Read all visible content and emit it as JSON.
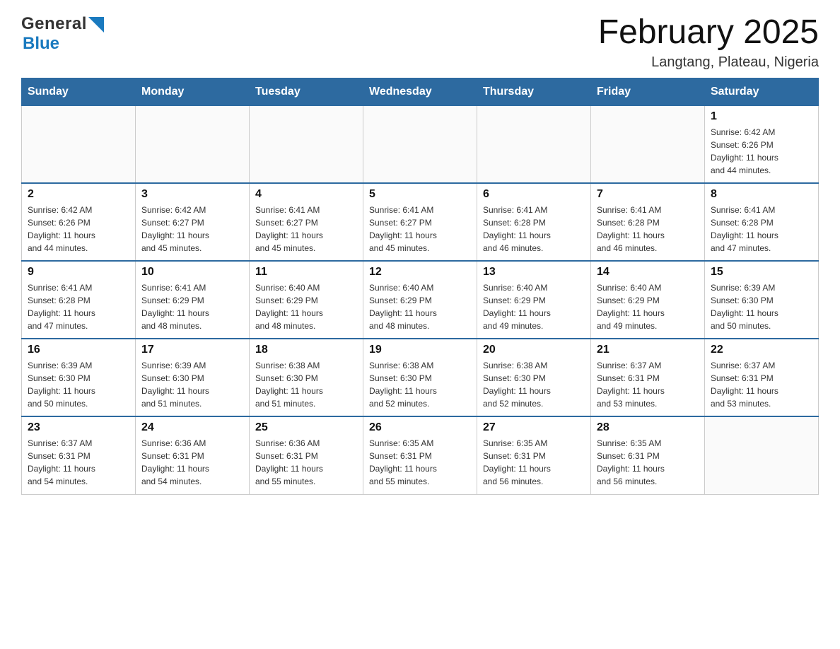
{
  "header": {
    "logo": {
      "general": "General",
      "blue": "Blue"
    },
    "title": "February 2025",
    "location": "Langtang, Plateau, Nigeria"
  },
  "days_of_week": [
    "Sunday",
    "Monday",
    "Tuesday",
    "Wednesday",
    "Thursday",
    "Friday",
    "Saturday"
  ],
  "weeks": [
    [
      {
        "day": "",
        "info": ""
      },
      {
        "day": "",
        "info": ""
      },
      {
        "day": "",
        "info": ""
      },
      {
        "day": "",
        "info": ""
      },
      {
        "day": "",
        "info": ""
      },
      {
        "day": "",
        "info": ""
      },
      {
        "day": "1",
        "info": "Sunrise: 6:42 AM\nSunset: 6:26 PM\nDaylight: 11 hours\nand 44 minutes."
      }
    ],
    [
      {
        "day": "2",
        "info": "Sunrise: 6:42 AM\nSunset: 6:26 PM\nDaylight: 11 hours\nand 44 minutes."
      },
      {
        "day": "3",
        "info": "Sunrise: 6:42 AM\nSunset: 6:27 PM\nDaylight: 11 hours\nand 45 minutes."
      },
      {
        "day": "4",
        "info": "Sunrise: 6:41 AM\nSunset: 6:27 PM\nDaylight: 11 hours\nand 45 minutes."
      },
      {
        "day": "5",
        "info": "Sunrise: 6:41 AM\nSunset: 6:27 PM\nDaylight: 11 hours\nand 45 minutes."
      },
      {
        "day": "6",
        "info": "Sunrise: 6:41 AM\nSunset: 6:28 PM\nDaylight: 11 hours\nand 46 minutes."
      },
      {
        "day": "7",
        "info": "Sunrise: 6:41 AM\nSunset: 6:28 PM\nDaylight: 11 hours\nand 46 minutes."
      },
      {
        "day": "8",
        "info": "Sunrise: 6:41 AM\nSunset: 6:28 PM\nDaylight: 11 hours\nand 47 minutes."
      }
    ],
    [
      {
        "day": "9",
        "info": "Sunrise: 6:41 AM\nSunset: 6:28 PM\nDaylight: 11 hours\nand 47 minutes."
      },
      {
        "day": "10",
        "info": "Sunrise: 6:41 AM\nSunset: 6:29 PM\nDaylight: 11 hours\nand 48 minutes."
      },
      {
        "day": "11",
        "info": "Sunrise: 6:40 AM\nSunset: 6:29 PM\nDaylight: 11 hours\nand 48 minutes."
      },
      {
        "day": "12",
        "info": "Sunrise: 6:40 AM\nSunset: 6:29 PM\nDaylight: 11 hours\nand 48 minutes."
      },
      {
        "day": "13",
        "info": "Sunrise: 6:40 AM\nSunset: 6:29 PM\nDaylight: 11 hours\nand 49 minutes."
      },
      {
        "day": "14",
        "info": "Sunrise: 6:40 AM\nSunset: 6:29 PM\nDaylight: 11 hours\nand 49 minutes."
      },
      {
        "day": "15",
        "info": "Sunrise: 6:39 AM\nSunset: 6:30 PM\nDaylight: 11 hours\nand 50 minutes."
      }
    ],
    [
      {
        "day": "16",
        "info": "Sunrise: 6:39 AM\nSunset: 6:30 PM\nDaylight: 11 hours\nand 50 minutes."
      },
      {
        "day": "17",
        "info": "Sunrise: 6:39 AM\nSunset: 6:30 PM\nDaylight: 11 hours\nand 51 minutes."
      },
      {
        "day": "18",
        "info": "Sunrise: 6:38 AM\nSunset: 6:30 PM\nDaylight: 11 hours\nand 51 minutes."
      },
      {
        "day": "19",
        "info": "Sunrise: 6:38 AM\nSunset: 6:30 PM\nDaylight: 11 hours\nand 52 minutes."
      },
      {
        "day": "20",
        "info": "Sunrise: 6:38 AM\nSunset: 6:30 PM\nDaylight: 11 hours\nand 52 minutes."
      },
      {
        "day": "21",
        "info": "Sunrise: 6:37 AM\nSunset: 6:31 PM\nDaylight: 11 hours\nand 53 minutes."
      },
      {
        "day": "22",
        "info": "Sunrise: 6:37 AM\nSunset: 6:31 PM\nDaylight: 11 hours\nand 53 minutes."
      }
    ],
    [
      {
        "day": "23",
        "info": "Sunrise: 6:37 AM\nSunset: 6:31 PM\nDaylight: 11 hours\nand 54 minutes."
      },
      {
        "day": "24",
        "info": "Sunrise: 6:36 AM\nSunset: 6:31 PM\nDaylight: 11 hours\nand 54 minutes."
      },
      {
        "day": "25",
        "info": "Sunrise: 6:36 AM\nSunset: 6:31 PM\nDaylight: 11 hours\nand 55 minutes."
      },
      {
        "day": "26",
        "info": "Sunrise: 6:35 AM\nSunset: 6:31 PM\nDaylight: 11 hours\nand 55 minutes."
      },
      {
        "day": "27",
        "info": "Sunrise: 6:35 AM\nSunset: 6:31 PM\nDaylight: 11 hours\nand 56 minutes."
      },
      {
        "day": "28",
        "info": "Sunrise: 6:35 AM\nSunset: 6:31 PM\nDaylight: 11 hours\nand 56 minutes."
      },
      {
        "day": "",
        "info": ""
      }
    ]
  ]
}
